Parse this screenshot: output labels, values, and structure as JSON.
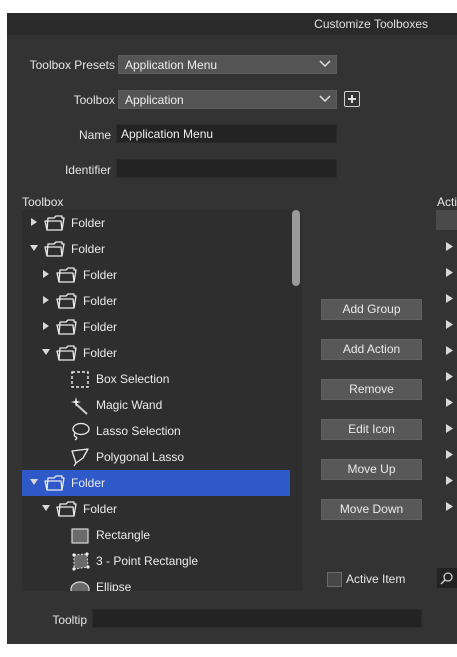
{
  "window": {
    "title": "Customize Toolboxes"
  },
  "form": {
    "toolbox_presets_label": "Toolbox Presets",
    "toolbox_presets_value": "Application Menu",
    "toolbox_label": "Toolbox",
    "toolbox_value": "Application",
    "name_label": "Name",
    "name_value": "Application Menu",
    "identifier_label": "Identifier",
    "identifier_value": ""
  },
  "tree": {
    "header": "Toolbox",
    "items": [
      {
        "label": "Folder",
        "kind": "folder",
        "expanded": false,
        "level": 0,
        "selected": false
      },
      {
        "label": "Folder",
        "kind": "folder",
        "expanded": true,
        "level": 0,
        "selected": false
      },
      {
        "label": "Folder",
        "kind": "folder",
        "expanded": false,
        "level": 1,
        "selected": false
      },
      {
        "label": "Folder",
        "kind": "folder",
        "expanded": false,
        "level": 1,
        "selected": false
      },
      {
        "label": "Folder",
        "kind": "folder",
        "expanded": false,
        "level": 1,
        "selected": false
      },
      {
        "label": "Folder",
        "kind": "folder",
        "expanded": true,
        "level": 1,
        "selected": false
      },
      {
        "label": "Box Selection",
        "kind": "tool",
        "icon": "box-selection-icon",
        "level": 2,
        "selected": false
      },
      {
        "label": "Magic Wand",
        "kind": "tool",
        "icon": "magic-wand-icon",
        "level": 2,
        "selected": false
      },
      {
        "label": "Lasso Selection",
        "kind": "tool",
        "icon": "lasso-icon",
        "level": 2,
        "selected": false
      },
      {
        "label": "Polygonal Lasso",
        "kind": "tool",
        "icon": "polygonal-lasso-icon",
        "level": 2,
        "selected": false
      },
      {
        "label": "Folder",
        "kind": "folder",
        "expanded": true,
        "level": 0,
        "selected": true
      },
      {
        "label": "Folder",
        "kind": "folder",
        "expanded": true,
        "level": 1,
        "selected": false
      },
      {
        "label": "Rectangle",
        "kind": "tool",
        "icon": "rectangle-icon",
        "level": 2,
        "selected": false
      },
      {
        "label": "3 - Point Rectangle",
        "kind": "tool",
        "icon": "three-point-rectangle-icon",
        "level": 2,
        "selected": false
      },
      {
        "label": "Ellipse",
        "kind": "tool",
        "icon": "ellipse-icon",
        "level": 2,
        "selected": false
      }
    ]
  },
  "buttons": {
    "add_group": "Add Group",
    "add_action": "Add Action",
    "remove": "Remove",
    "edit_icon": "Edit Icon",
    "move_up": "Move Up",
    "move_down": "Move Down"
  },
  "actions_panel": {
    "header": "Acti"
  },
  "active_item": {
    "label": "Active Item",
    "checked": false
  },
  "tooltip": {
    "label": "Tooltip",
    "value": ""
  },
  "colors": {
    "selection": "#2f58c8",
    "background": "#333333"
  }
}
